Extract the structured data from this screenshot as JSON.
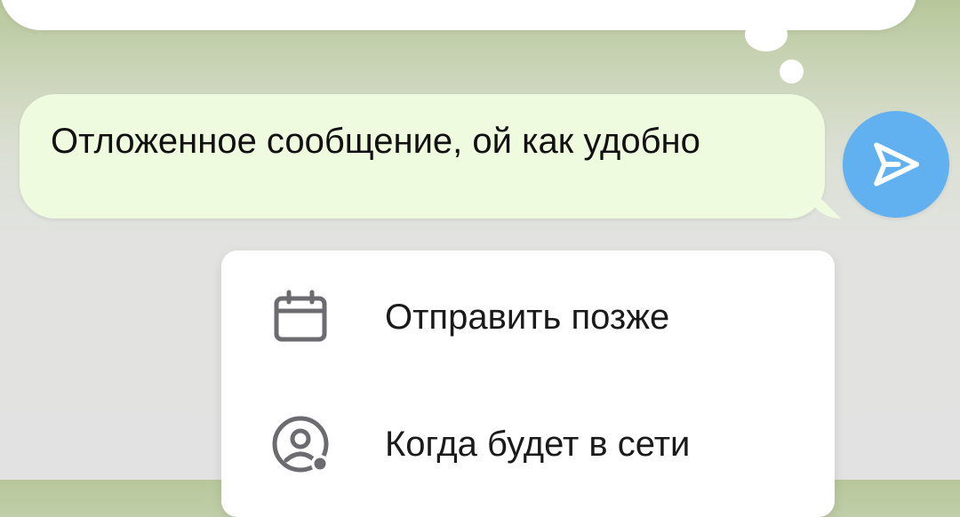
{
  "message": {
    "text": "Отложенное сообщение, ой как удобно"
  },
  "send": {
    "icon": "send-icon",
    "color": "#61b1f0"
  },
  "menu": {
    "items": [
      {
        "label": "Отправить позже",
        "icon": "calendar-icon"
      },
      {
        "label": "Когда будет в сети",
        "icon": "user-online-icon"
      }
    ]
  },
  "colors": {
    "bubble": "#eefbdf",
    "menu_bg": "#ffffff",
    "icon_gray": "#6b6b70",
    "accent": "#61b1f0"
  }
}
